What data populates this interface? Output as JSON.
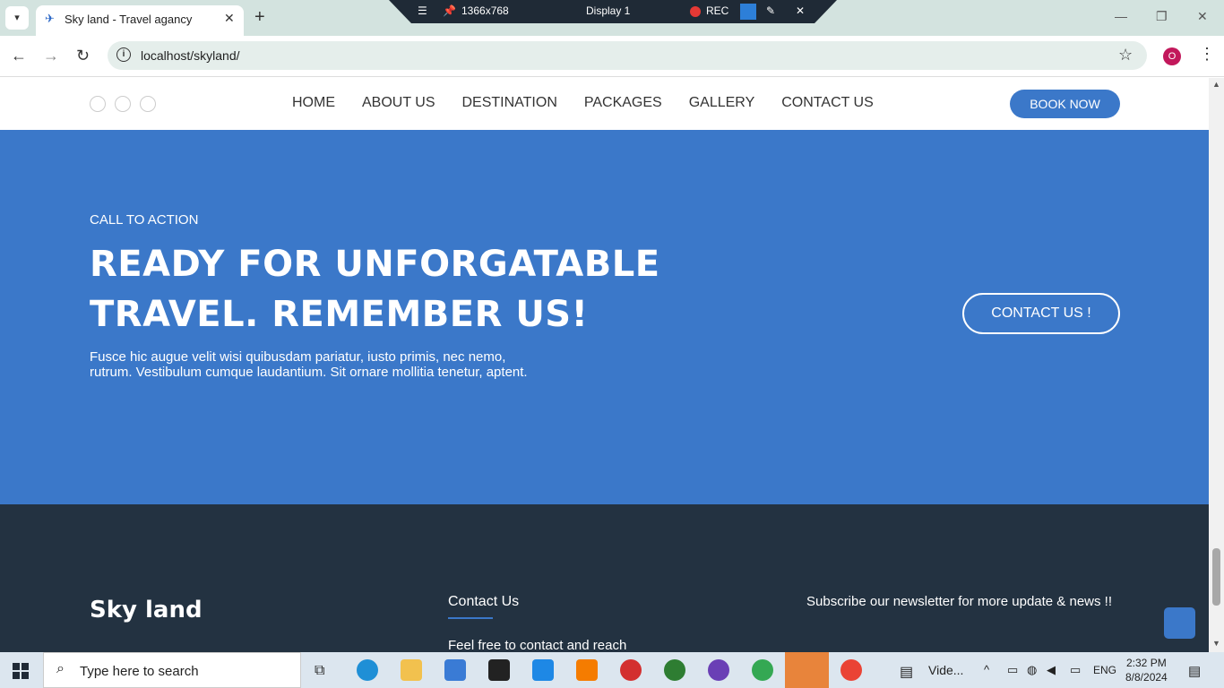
{
  "browser": {
    "tab_title": "Sky land - Travel agancy",
    "url": "localhost/skyland/",
    "profile_initial": "O"
  },
  "recorder": {
    "resolution": "1366x768",
    "display": "Display 1",
    "rec_label": "REC"
  },
  "site": {
    "nav": [
      "HOME",
      "ABOUT US",
      "DESTINATION",
      "PACKAGES",
      "GALLERY",
      "CONTACT US"
    ],
    "book_now": "BOOK NOW",
    "hero": {
      "label": "CALL TO ACTION",
      "heading_line1": "READY FOR UNFORGATABLE",
      "heading_line2": "TRAVEL. REMEMBER US!",
      "text_line1": "Fusce hic augue velit wisi quibusdam pariatur, iusto primis, nec nemo,",
      "text_line2": "rutrum. Vestibulum cumque laudantium. Sit ornare mollitia tenetur, aptent.",
      "button": "CONTACT US !"
    },
    "footer": {
      "brand": "Sky land",
      "contact_title": "Contact Us",
      "contact_text": "Feel free to contact and reach",
      "newsletter": "Subscribe our newsletter for more update & news !!"
    }
  },
  "taskbar": {
    "search_placeholder": "Type here to search",
    "video_label": "Vide...",
    "language": "ENG",
    "time": "2:32 PM",
    "date": "8/8/2024"
  },
  "colors": {
    "accent": "#3b78c9",
    "footer_bg": "#233241"
  }
}
